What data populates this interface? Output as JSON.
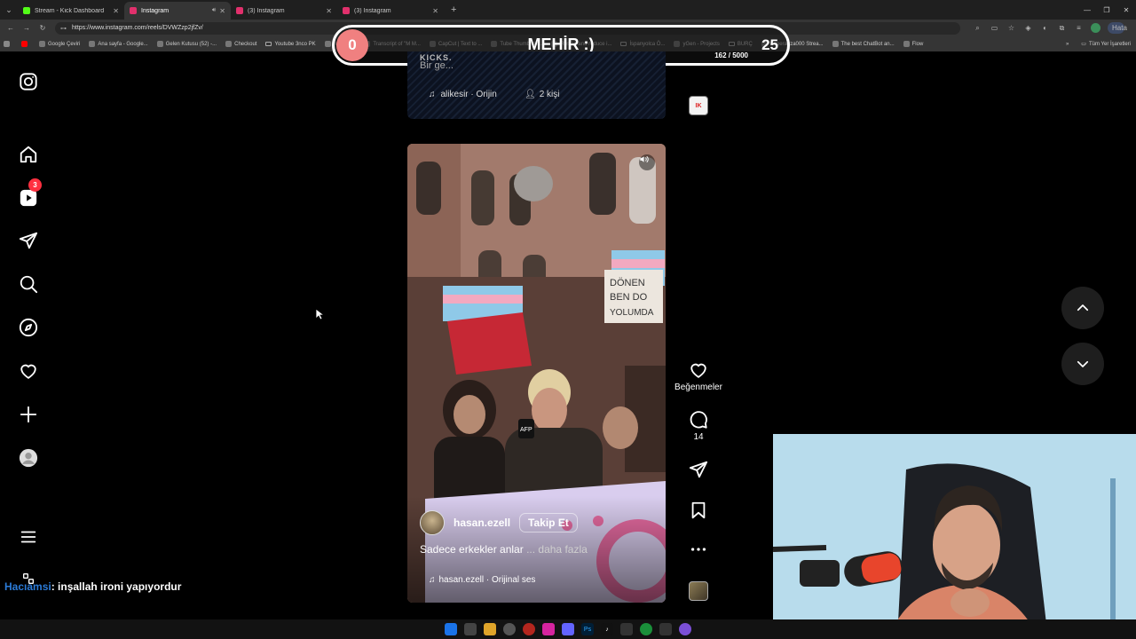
{
  "browser": {
    "tabs": [
      {
        "title": "Stream - Kick Dashboard",
        "favicon_color": "#53fc18",
        "active": false
      },
      {
        "title": "Instagram",
        "favicon_color": "#e1306c",
        "active": true
      },
      {
        "title": "(3) Instagram",
        "favicon_color": "#e1306c",
        "active": false
      },
      {
        "title": "(3) Instagram",
        "favicon_color": "#e1306c",
        "active": false
      }
    ],
    "url": "https://www.instagram.com/reels/DVWZzp2jfZv/",
    "profile_button": "Hata",
    "bookmarks": [
      {
        "label": "Google Çeviri",
        "folder": false
      },
      {
        "label": "Ana sayfa - Google...",
        "folder": false
      },
      {
        "label": "Gelen Kutusu (52) -...",
        "folder": false
      },
      {
        "label": "Checkout",
        "folder": false
      },
      {
        "label": "Youtube 3nco PK",
        "folder": true
      },
      {
        "label": "ng Örnek",
        "folder": false
      },
      {
        "label": "Transcript of \"M M...",
        "folder": false
      },
      {
        "label": "CapCut | Text to ...",
        "folder": false
      },
      {
        "label": "Tube Thumbnail...",
        "folder": false
      },
      {
        "label": "Resize and reduce i...",
        "folder": false
      },
      {
        "label": "İspanyolca Ö...",
        "folder": true
      },
      {
        "label": "yGen - Projects",
        "folder": false
      },
      {
        "label": "BURÇ",
        "folder": true
      },
      {
        "label": "Esperanza000 Strea...",
        "folder": false
      },
      {
        "label": "The best ChatBot an...",
        "folder": false
      },
      {
        "label": "Flow",
        "folder": false
      }
    ],
    "bookmarks_right": "Tüm Yer İşaretleri"
  },
  "overlay": {
    "left_score": "0",
    "name": "MEHİR :)",
    "right_score": "25",
    "char_count": "162 / 5000"
  },
  "sidebar": {
    "notification_count": "3"
  },
  "previous_reel": {
    "text_top": "KICKS.",
    "text_line": "Bir ge...",
    "audio": "alikesir · Orijin",
    "people": "2 kişi"
  },
  "reel": {
    "username": "hasan.ezell",
    "follow_label": "Takip Et",
    "caption": "Sadece erkekler anlar",
    "caption_more": "... daha fazla",
    "audio": "hasan.ezell · Orijinal ses",
    "sign_text_1": "DÖNEN",
    "sign_text_2": "BEN DO",
    "sign_text_3": "YOLUMDA",
    "mic_text": "AFP"
  },
  "actions": {
    "likes_label": "Beğenmeler",
    "comments_count": "14"
  },
  "chat": {
    "user": "Hacıamsi",
    "message": ": inşallah ironi yapıyordur"
  }
}
